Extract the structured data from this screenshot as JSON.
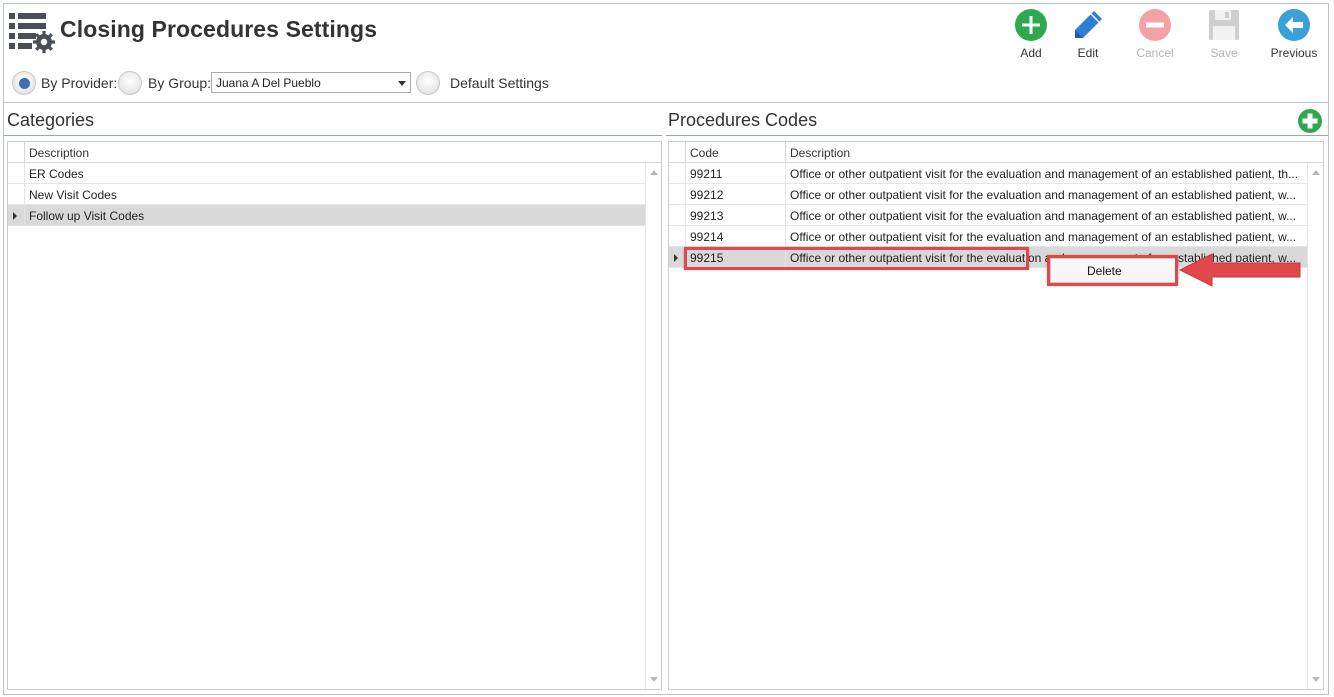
{
  "header": {
    "title": "Closing Procedures Settings",
    "app_icon": "list-settings-icon"
  },
  "toolbar": {
    "buttons": [
      {
        "label": "Add",
        "icon": "plus-circle-icon",
        "color": "#2ea94f",
        "enabled": true
      },
      {
        "label": "Edit",
        "icon": "pencil-icon",
        "color": "#2d7fd3",
        "enabled": true
      },
      {
        "label": "Cancel",
        "icon": "cancel-circle-icon",
        "color": "#f08a8a",
        "enabled": false
      },
      {
        "label": "Save",
        "icon": "floppy-disk-icon",
        "color": "#c8c8c8",
        "enabled": false
      },
      {
        "label": "Previous",
        "icon": "arrow-left-circle-icon",
        "color": "#3aa0d8",
        "enabled": true
      }
    ]
  },
  "filter": {
    "by_provider_label": "By Provider:",
    "by_group_label": "By Group:",
    "provider_value": "Juana A Del Pueblo",
    "default_settings_label": "Default Settings",
    "selected": "by_provider"
  },
  "categories": {
    "title": "Categories",
    "columns": [
      "Description"
    ],
    "rows": [
      {
        "description": "ER Codes",
        "selected": false
      },
      {
        "description": "New Visit Codes",
        "selected": false
      },
      {
        "description": "Follow up Visit Codes",
        "selected": true
      }
    ]
  },
  "procedures": {
    "title": "Procedures Codes",
    "add_icon": "plus-circle-icon",
    "columns": [
      "Code",
      "Description"
    ],
    "rows": [
      {
        "code": "99211",
        "description": "Office or other outpatient visit for the evaluation and management of an established patient, th...",
        "selected": false
      },
      {
        "code": "99212",
        "description": "Office or other outpatient visit for the evaluation and management of an established patient, w...",
        "selected": false
      },
      {
        "code": "99213",
        "description": "Office or other outpatient visit for the evaluation and management of an established patient, w...",
        "selected": false
      },
      {
        "code": "99214",
        "description": "Office or other outpatient visit for the evaluation and management of an established patient, w...",
        "selected": false
      },
      {
        "code": "99215",
        "description": "Office or other outpatient visit for the evaluation and management of an established patient, w...",
        "selected": true
      }
    ]
  },
  "context_menu": {
    "items": [
      "Delete"
    ]
  },
  "colors": {
    "accent": "#3b6fb0",
    "highlight": "#e2474b",
    "selected_row": "#d9d9d9"
  }
}
